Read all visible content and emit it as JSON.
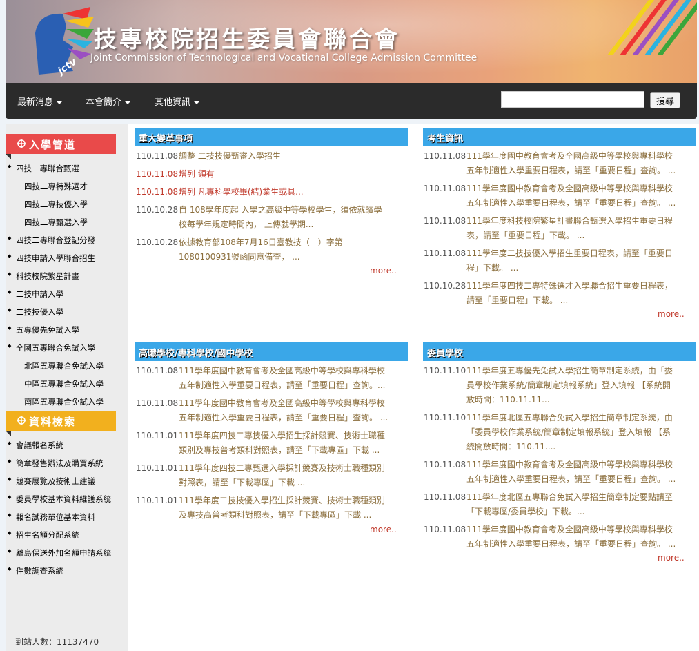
{
  "header": {
    "title_zh": "技專校院招生委員會聯合會",
    "title_en": "Joint Commission of Technological and Vocational College Admission Committee",
    "logo_text": "jctv"
  },
  "nav": {
    "items": [
      "最新消息",
      "本會簡介",
      "其他資訊"
    ],
    "search_value": "",
    "search_button": "搜尋"
  },
  "sidebar": {
    "section1_title": "入學管道",
    "section1_items": [
      {
        "label": "四技二專聯合甄選",
        "bullet": true
      },
      {
        "label": "四技二專特殊選才",
        "bullet": false
      },
      {
        "label": "四技二專技優入學",
        "bullet": false
      },
      {
        "label": "四技二專甄選入學",
        "bullet": false
      },
      {
        "label": "四技二專聯合登記分發",
        "bullet": true
      },
      {
        "label": "四技申請入學聯合招生",
        "bullet": true
      },
      {
        "label": "科技校院繁星計畫",
        "bullet": true
      },
      {
        "label": "二技申請入學",
        "bullet": true
      },
      {
        "label": "二技技優入學",
        "bullet": true
      },
      {
        "label": "五專優先免試入學",
        "bullet": true
      },
      {
        "label": "全國五專聯合免試入學",
        "bullet": true
      },
      {
        "label": "北區五專聯合免試入學",
        "bullet": false
      },
      {
        "label": "中區五專聯合免試入學",
        "bullet": false
      },
      {
        "label": "南區五專聯合免試入學",
        "bullet": false
      }
    ],
    "section2_title": "資料檢索",
    "section2_items": [
      "會議報名系統",
      "簡章發售辦法及購買系統",
      "競賽展覽及技術士建議",
      "委員學校基本資料維護系統",
      "報名試務單位基本資料",
      "招生名額分配系統",
      "離島保送外加名額申請系統",
      "件數調查系統"
    ],
    "visitor_label": "到站人數：",
    "visitor_count": "11137470"
  },
  "colors": {
    "panel_header": "#3aa7e8",
    "sidebar_red": "#e94a4a",
    "sidebar_yellow": "#f2b01e",
    "link_text": "#8a6d3b",
    "highlight_red": "#c0392b"
  },
  "panels": {
    "major_changes": {
      "title": "重大變革事項",
      "items": [
        {
          "date": "110.11.08",
          "text": [
            "調整 二技技優甄審入學招生"
          ],
          "red": false
        },
        {
          "date": "110.11.08",
          "text": [
            "增列 領有"
          ],
          "red": true
        },
        {
          "date": "110.11.08",
          "text": [
            "增列 凡專科學校畢(結)業生或具..."
          ],
          "red": true
        },
        {
          "date": "110.10.28",
          "text": [
            "自 108學年度起 入學之高級中等學校學生，須依就讀學",
            "校每學年規定時間內， 上傳就學期..."
          ],
          "red": false
        },
        {
          "date": "110.10.28",
          "text": [
            "依據教育部108年7月16日臺教技（一）字第",
            "1080100931號函同意備查， ..."
          ],
          "red": false
        }
      ],
      "more": "more.."
    },
    "student_info": {
      "title": "考生資訊",
      "items": [
        {
          "date": "110.11.08",
          "text": [
            "111學年度國中教育會考及全國高級中等學校與專科學校",
            "五年制適性入學重要日程表，請至「重要日程」查詢。 ..."
          ]
        },
        {
          "date": "110.11.08",
          "text": [
            "111學年度國中教育會考及全國高級中等學校與專科學校",
            "五年制適性入學重要日程表，請至「重要日程」查詢。 ..."
          ]
        },
        {
          "date": "110.11.08",
          "text": [
            "111學年度科技校院繁星計畫聯合甄選入學招生重要日程",
            "表，請至「重要日程」下載。 ..."
          ]
        },
        {
          "date": "110.11.08",
          "text": [
            "111學年度二技技優入學招生重要日程表，請至「重要日",
            "程」下載。 ..."
          ]
        },
        {
          "date": "110.10.28",
          "text": [
            "111學年度四技二專特殊選才入學聯合招生重要日程表，",
            "請至「重要日程」下載。 ..."
          ]
        }
      ],
      "more": "more.."
    },
    "schools": {
      "title": "高職學校/專科學校/國中學校",
      "items": [
        {
          "date": "110.11.08",
          "text": [
            "111學年度國中教育會考及全國高級中等學校與專科學校",
            "五年制適性入學重要日程表，請至「重要日程」查詢。..."
          ]
        },
        {
          "date": "110.11.08",
          "text": [
            "111學年度國中教育會考及全國高級中等學校與專科學校",
            "五年制適性入學重要日程表，請至「重要日程」查詢。 ..."
          ]
        },
        {
          "date": "110.11.01",
          "text": [
            "111學年度四技二專技優入學招生採計競賽、技術士職種",
            "類別及專技普考類科對照表，請至「下載專區」下載 ..."
          ]
        },
        {
          "date": "110.11.01",
          "text": [
            "111學年度四技二專甄選入學採計競賽及技術士職種類別",
            "對照表，請至「下載專區」下載 ..."
          ]
        },
        {
          "date": "110.11.01",
          "text": [
            "111學年度二技技優入學招生採計競賽、技術士職種類別",
            "及專技高普考類科對照表，請至「下載專區」下載 ..."
          ]
        }
      ],
      "more": "more.."
    },
    "member_schools": {
      "title": "委員學校",
      "items": [
        {
          "date": "110.11.10",
          "text": [
            "111學年度五專優先免試入學招生簡章制定系統，由「委",
            "員學校作業系統/簡章制定填報系統」登入填報 【系統開",
            "放時間：110.11.11..."
          ]
        },
        {
          "date": "110.11.10",
          "text": [
            "111學年度北區五專聯合免試入學招生簡章制定系統，由",
            "「委員學校作業系統/簡章制定填報系統」登入填報 【系",
            "統開放時間：110.11...."
          ]
        },
        {
          "date": "110.11.08",
          "text": [
            "111學年度國中教育會考及全國高級中等學校與專科學校",
            "五年制適性入學重要日程表，請至「重要日程」查詢。 ..."
          ]
        },
        {
          "date": "110.11.08",
          "text": [
            "111學年度北區五專聯合免試入學招生簡章制定要點請至",
            "「下載專區/委員學校」下載。..."
          ]
        },
        {
          "date": "110.11.08",
          "text": [
            "111學年度國中教育會考及全國高級中等學校與專科學校",
            "五年制適性入學重要日程表，請至「重要日程」查詢。 ..."
          ]
        }
      ],
      "more": "more.."
    }
  }
}
